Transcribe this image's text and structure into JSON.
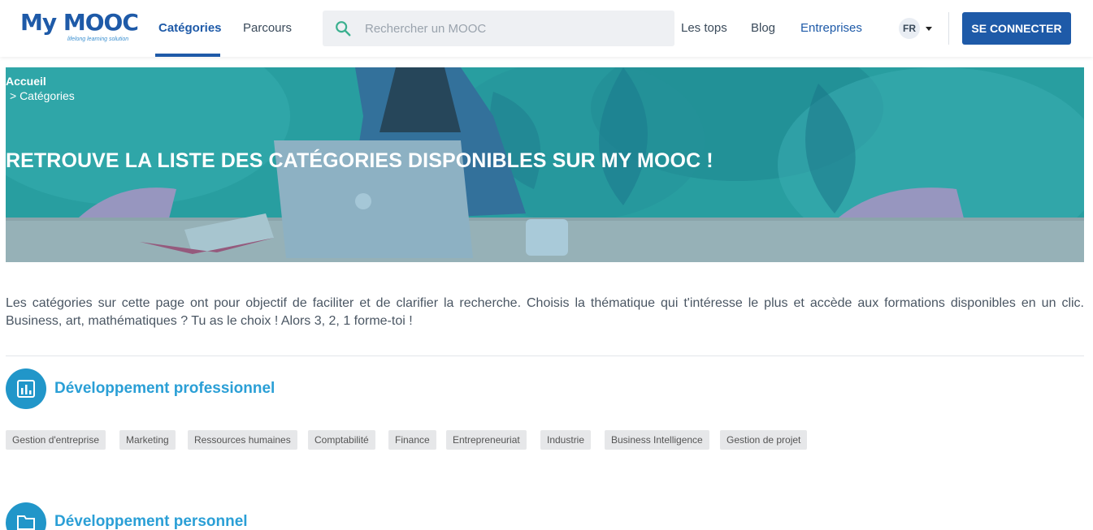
{
  "header": {
    "logo_text": "My MOOC",
    "logo_tagline": "lifelong learning solution",
    "nav": {
      "categories": "Catégories",
      "parcours": "Parcours",
      "tops": "Les tops",
      "blog": "Blog",
      "entreprises": "Entreprises"
    },
    "search_placeholder": "Rechercher un MOOC",
    "language": "FR",
    "connect_label": "SE CONNECTER"
  },
  "hero": {
    "breadcrumb_home": "Accueil",
    "breadcrumb_current": "> Catégories",
    "title": "RETROUVE LA LISTE DES CATÉGORIES DISPONIBLES SUR MY MOOC !"
  },
  "intro": "Les catégories sur cette page ont pour objectif de faciliter et de clarifier la recherche. Choisis la thématique qui t'intéresse le plus et accède aux formations disponibles en un clic. Business, art, mathématiques ? Tu as le choix ! Alors 3, 2, 1 forme-toi !",
  "categories": [
    {
      "title": "Développement professionnel",
      "icon": "bar-chart-icon",
      "tags": [
        "Gestion d'entreprise",
        "Marketing",
        "Ressources humaines",
        "Comptabilité",
        "Finance",
        "Entrepreneuriat",
        "Industrie",
        "Business Intelligence",
        "Gestion de projet"
      ]
    },
    {
      "title": "Développement personnel",
      "icon": "folder-icon",
      "tags": []
    }
  ],
  "colors": {
    "brand_blue": "#1e5aa8",
    "category_blue": "#2a9fd6",
    "tag_bg": "#e6e7e9"
  }
}
